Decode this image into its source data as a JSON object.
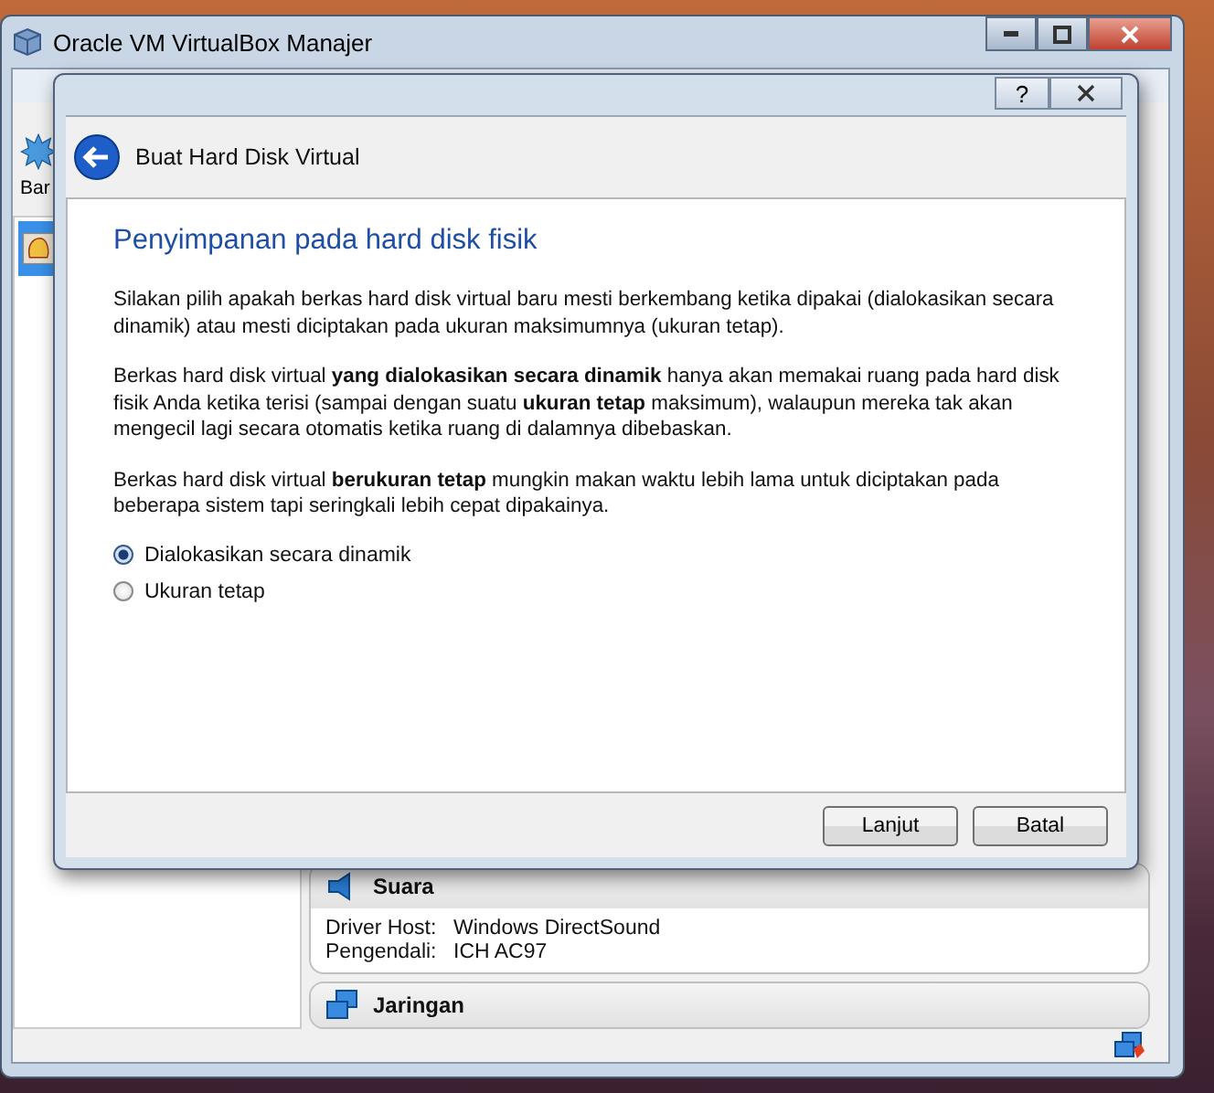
{
  "main_window": {
    "title": "Oracle VM VirtualBox Manajer",
    "toolbar": [
      {
        "label": "Bar"
      }
    ],
    "details": [
      {
        "kind": "audio",
        "title": "Suara",
        "rows": [
          {
            "label": "Driver Host:",
            "value": "Windows DirectSound"
          },
          {
            "label": "Pengendali:",
            "value": "ICH AC97"
          }
        ]
      },
      {
        "kind": "network",
        "title": "Jaringan"
      }
    ]
  },
  "dialog": {
    "help": "?",
    "title": "Buat Hard Disk Virtual",
    "heading": "Penyimpanan pada hard disk fisik",
    "paragraphs": [
      "Silakan pilih apakah berkas hard disk virtual baru mesti berkembang ketika dipakai (dialokasikan secara dinamik) atau mesti diciptakan pada ukuran maksimumnya (ukuran tetap).",
      "Berkas hard disk virtual **yang dialokasikan secara dinamik** hanya akan memakai ruang pada hard disk fisik Anda ketika terisi (sampai dengan suatu **ukuran tetap** maksimum), walaupun mereka tak akan mengecil lagi secara otomatis ketika ruang di dalamnya dibebaskan.",
      "Berkas hard disk virtual **berukuran tetap** mungkin makan waktu lebih lama untuk diciptakan pada beberapa sistem tapi seringkali lebih cepat dipakainya."
    ],
    "options": [
      {
        "label": "Dialokasikan secara dinamik",
        "selected": true
      },
      {
        "label": "Ukuran tetap",
        "selected": false
      }
    ],
    "buttons": [
      "Lanjut",
      "Batal"
    ]
  }
}
